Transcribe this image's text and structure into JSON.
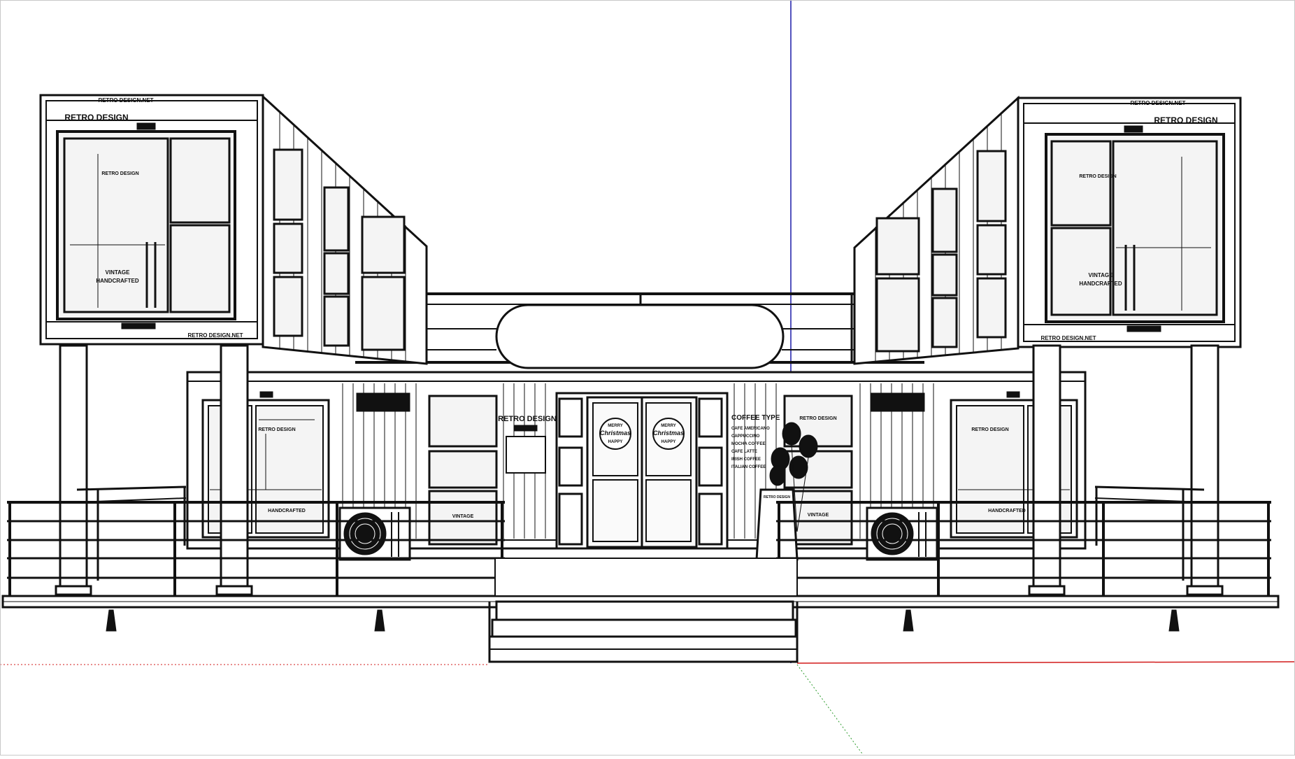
{
  "model": {
    "container_top_label": "RETRO DESIGN.NET",
    "container_bottom_label": "RETRO DESIGN.NET",
    "brand_name": "RETRO DESIGN",
    "center_brand": "RETRO DESIGN",
    "small_label": "RETRO DESIGN",
    "window_sticker": "VINTAGE",
    "window_sticker_2": "HANDCRAFTED",
    "lower_sticker": "HANDCRAFTED",
    "christmas_text": "Christmas",
    "christmas_merry": "MERRY",
    "christmas_happy": "HAPPY",
    "menu_title": "COFFEE TYPE",
    "menu_items": [
      "CAFE AMERICANO",
      "CAPPUCCINO",
      "MOCHA COFFEE",
      "CAFE LATTE",
      "IRISH COFFEE",
      "ITALIAN COFFEE"
    ],
    "sign_text": "RETRO DESIGN"
  },
  "colors": {
    "line": "#111111",
    "blue_axis": "#1a1aa8",
    "red_axis": "#d21a1a",
    "background": "#ffffff",
    "glass": "#f4f4f4"
  }
}
